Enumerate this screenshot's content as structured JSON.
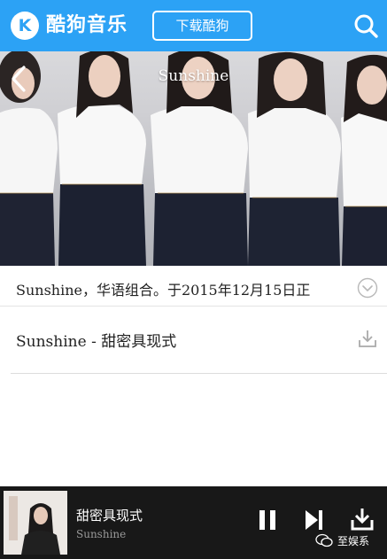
{
  "header": {
    "logo_text": "酷狗音乐",
    "download_app_label": "下载酷狗"
  },
  "hero": {
    "title": "Sunshine"
  },
  "artist": {
    "intro": "Sunshine，华语组合。于2015年12月15日正"
  },
  "song": {
    "title": "Sunshine - 甜密具现式"
  },
  "player": {
    "track_title": "甜密具现式",
    "artist": "Sunshine",
    "state": "playing"
  },
  "watermark": {
    "text": "至娱系"
  },
  "colors": {
    "brand_blue": "#2ca2f5",
    "player_bg": "#181818"
  }
}
